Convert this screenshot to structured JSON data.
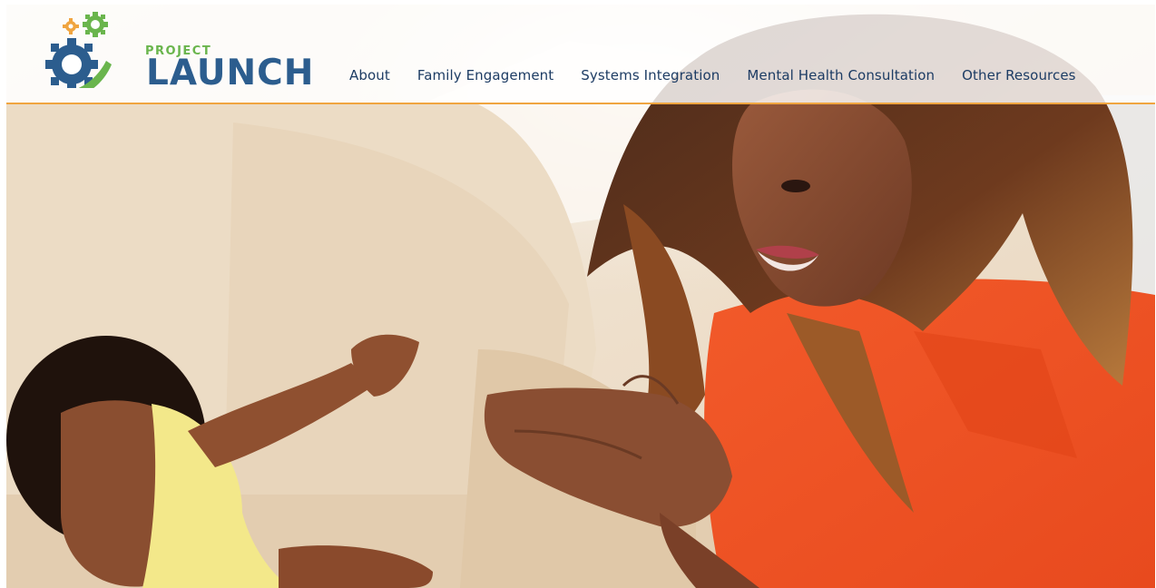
{
  "brand": {
    "project_label": "PROJECT",
    "launch_label": "LAUNCH",
    "colors": {
      "blue": "#2c5d8e",
      "green": "#6ab54d",
      "orange": "#f0a540"
    }
  },
  "nav": {
    "items": [
      {
        "label": "About"
      },
      {
        "label": "Family Engagement"
      },
      {
        "label": "Systems Integration"
      },
      {
        "label": "Mental Health Consultation"
      },
      {
        "label": "Other Resources"
      }
    ]
  },
  "hero": {
    "icon": "photo-mother-clapping-with-baby"
  }
}
